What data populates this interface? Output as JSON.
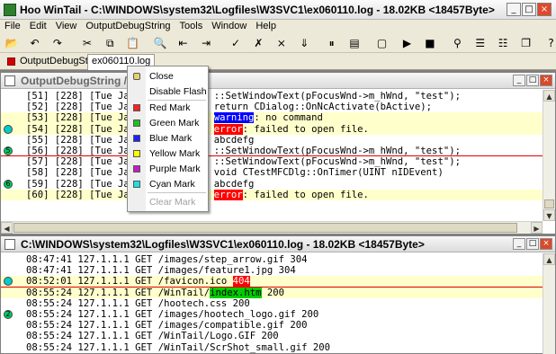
{
  "window": {
    "title": "Hoo WinTail - C:\\WINDOWS\\system32\\Logfiles\\W3SVC1\\ex060110.log - 18.02KB <18457Byte>",
    "minimize_glyph": "_",
    "maximize_glyph": "□",
    "close_glyph": "×"
  },
  "menubar": {
    "items": [
      "File",
      "Edit",
      "View",
      "OutputDebugString",
      "Tools",
      "Window",
      "Help"
    ]
  },
  "toolbar": {
    "icons": [
      "open-icon",
      "undo-icon",
      "redo-icon",
      "cut-icon",
      "copy-icon",
      "paste-icon",
      "find-icon",
      "find-prev-icon",
      "find-next-icon",
      "mark-icon",
      "clear-mark-icon",
      "close-file-icon",
      "tail-icon",
      "pause-icon",
      "filter-icon",
      "window-icon",
      "play-icon",
      "stop-icon",
      "pin-icon",
      "tile-h-icon",
      "tile-v-icon",
      "cascade-icon",
      "about-icon"
    ],
    "glyphs": [
      "📂",
      "↶",
      "↷",
      "✂",
      "⧉",
      "📋",
      "🔍",
      "⇤",
      "⇥",
      "✓",
      "✗",
      "⨯",
      "⇓",
      "⏸",
      "▤",
      "▢",
      "▶",
      "■",
      "⚲",
      "☰",
      "☷",
      "❐",
      "?"
    ]
  },
  "tabs": [
    {
      "label": "OutputDebugString",
      "active": false
    },
    {
      "label": "ex060110.log",
      "active": true
    }
  ],
  "panel_top": {
    "title": "OutputDebugString / TRACE",
    "lines": [
      {
        "pre": "[51] [228] [Tue Jan",
        "post": "06] ::SetWindowText(pFocusWnd->m_hWnd, \"test\");",
        "hl": "",
        "hl_type": "",
        "rest": "",
        "yellow": false,
        "marker": "",
        "marker_color": "",
        "sep": false
      },
      {
        "pre": "[52] [228] [Tue Jan",
        "post": "06] return CDialog::OnNcActivate(bActive);",
        "hl": "",
        "hl_type": "",
        "rest": "",
        "yellow": false,
        "marker": "",
        "marker_color": "",
        "sep": false
      },
      {
        "pre": "[53] [228] [Tue Jan",
        "post": "06] ",
        "hl": "warning",
        "hl_type": "blue",
        "rest": ": no command",
        "yellow": true,
        "marker": "",
        "marker_color": "",
        "sep": false
      },
      {
        "pre": "[54] [228] [Tue Jan",
        "post": "06] ",
        "hl": "error",
        "hl_type": "red",
        "rest": ": failed to open file.",
        "yellow": true,
        "marker": "",
        "marker_color": "#00cccc",
        "sep": false
      },
      {
        "pre": "[55] [228] [Tue Jan",
        "post": "06] abcdefg",
        "hl": "",
        "hl_type": "",
        "rest": "",
        "yellow": false,
        "marker": "",
        "marker_color": "",
        "sep": false
      },
      {
        "pre": "[56] [228] [Tue Jan",
        "post": "06] ::SetWindowText(pFocusWnd->m_hWnd, \"test\");",
        "hl": "",
        "hl_type": "",
        "rest": "",
        "yellow": false,
        "marker": "5",
        "marker_color": "#00cc66",
        "sep": true
      },
      {
        "pre": "[57] [228] [Tue Jan",
        "post": "06] ::SetWindowText(pFocusWnd->m_hWnd, \"test\");",
        "hl": "",
        "hl_type": "",
        "rest": "",
        "yellow": false,
        "marker": "",
        "marker_color": "",
        "sep": false
      },
      {
        "pre": "[58] [228] [Tue Jan",
        "post": "06] void CTestMFCDlg::OnTimer(UINT nIDEvent)",
        "hl": "",
        "hl_type": "",
        "rest": "",
        "yellow": false,
        "marker": "",
        "marker_color": "",
        "sep": false
      },
      {
        "pre": "[59] [228] [Tue Jan",
        "post": "06] abcdefg",
        "hl": "",
        "hl_type": "",
        "rest": "",
        "yellow": false,
        "marker": "6",
        "marker_color": "#00cc66",
        "sep": false
      },
      {
        "pre": "[60] [228] [Tue Jan",
        "post": "06] ",
        "hl": "error",
        "hl_type": "red",
        "rest": ": failed to open file.",
        "yellow": true,
        "marker": "",
        "marker_color": "",
        "sep": false
      }
    ]
  },
  "panel_bottom": {
    "title": "C:\\WINDOWS\\system32\\Logfiles\\W3SVC1\\ex060110.log - 18.02KB <18457Byte>",
    "lines": [
      {
        "pre": "08:47:41 127.1.1.1 GET /images/step_arrow.gif 304",
        "hl": "",
        "hl_type": "",
        "rest": "",
        "yellow": false,
        "marker": "",
        "marker_color": "",
        "sep": false
      },
      {
        "pre": "08:47:41 127.1.1.1 GET /images/feature1.jpg 304",
        "hl": "",
        "hl_type": "",
        "rest": "",
        "yellow": false,
        "marker": "",
        "marker_color": "",
        "sep": false
      },
      {
        "pre": "08:52:01 127.1.1.1 GET /favicon.ico ",
        "hl": "404",
        "hl_type": "red",
        "rest": "",
        "yellow": true,
        "marker": "",
        "marker_color": "#00cccc",
        "sep": true
      },
      {
        "pre": "08:55:24 127.1.1.1 GET /WinTail/",
        "hl": "index.htm",
        "hl_type": "green",
        "rest": " 200",
        "yellow": true,
        "marker": "",
        "marker_color": "",
        "sep": false
      },
      {
        "pre": "08:55:24 127.1.1.1 GET /hootech.css 200",
        "hl": "",
        "hl_type": "",
        "rest": "",
        "yellow": false,
        "marker": "",
        "marker_color": "",
        "sep": false
      },
      {
        "pre": "08:55:24 127.1.1.1 GET /images/hootech_logo.gif 200",
        "hl": "",
        "hl_type": "",
        "rest": "",
        "yellow": false,
        "marker": "2",
        "marker_color": "#00cc66",
        "sep": false
      },
      {
        "pre": "08:55:24 127.1.1.1 GET /images/compatible.gif 200",
        "hl": "",
        "hl_type": "",
        "rest": "",
        "yellow": false,
        "marker": "",
        "marker_color": "",
        "sep": false
      },
      {
        "pre": "08:55:24 127.1.1.1 GET /WinTail/Logo.GIF 200",
        "hl": "",
        "hl_type": "",
        "rest": "",
        "yellow": false,
        "marker": "",
        "marker_color": "",
        "sep": false
      },
      {
        "pre": "08:55:24 127.1.1.1 GET /WinTail/ScrShot_small.gif 200",
        "hl": "",
        "hl_type": "",
        "rest": "",
        "yellow": false,
        "marker": "",
        "marker_color": "",
        "sep": false
      }
    ]
  },
  "context_menu": {
    "items": [
      {
        "label": "Close",
        "swatch": "",
        "disabled": false,
        "icon": "close-file-icon"
      },
      {
        "label": "Disable Flash",
        "swatch": "",
        "disabled": false,
        "icon": ""
      },
      {
        "label": "Red Mark",
        "swatch": "#ff2020",
        "disabled": false,
        "icon": ""
      },
      {
        "label": "Green Mark",
        "swatch": "#20c020",
        "disabled": false,
        "icon": ""
      },
      {
        "label": "Blue Mark",
        "swatch": "#2020ff",
        "disabled": false,
        "icon": ""
      },
      {
        "label": "Yellow Mark",
        "swatch": "#ffff00",
        "disabled": false,
        "icon": ""
      },
      {
        "label": "Purple Mark",
        "swatch": "#c020c0",
        "disabled": false,
        "icon": ""
      },
      {
        "label": "Cyan Mark",
        "swatch": "#20e0e0",
        "disabled": false,
        "icon": ""
      },
      {
        "label": "Clear Mark",
        "swatch": "",
        "disabled": true,
        "icon": ""
      }
    ]
  }
}
